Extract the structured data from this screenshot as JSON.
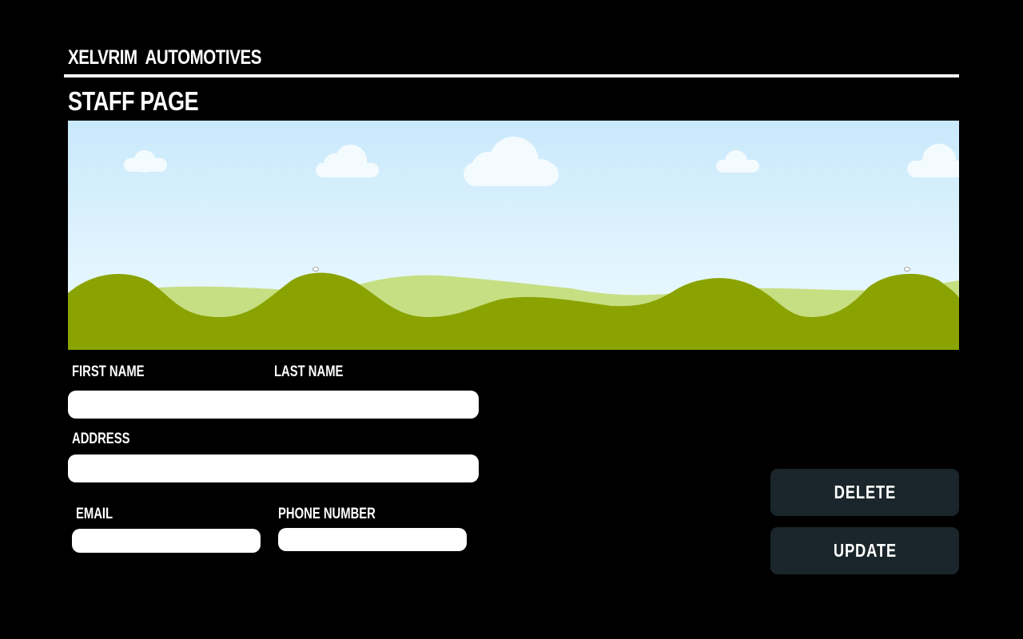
{
  "header": {
    "brand": "XELVRIM  AUTOMOTIVES",
    "page_title": "STAFF PAGE"
  },
  "form": {
    "first_name_label": "FIRST NAME",
    "last_name_label": "LAST NAME",
    "address_label": "ADDRESS",
    "email_label": "EMAIL",
    "phone_label": "PHONE NUMBER",
    "name_value": "",
    "address_value": "",
    "email_value": "",
    "phone_value": ""
  },
  "actions": {
    "delete_label": "DELETE",
    "update_label": "UPDATE"
  },
  "colors": {
    "background": "#000000",
    "button": "#1b262c",
    "sky_top": "#c9e9fb",
    "hill_dark": "#8aa300",
    "hill_light": "#c6df82"
  }
}
